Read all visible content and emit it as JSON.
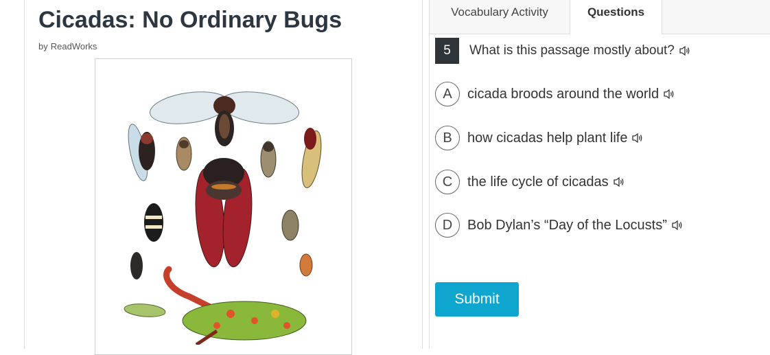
{
  "article": {
    "title": "Cicadas: No Ordinary Bugs",
    "byline_prefix": "by",
    "author": "ReadWorks"
  },
  "tabs": [
    {
      "label": "Vocabulary Activity",
      "active": false
    },
    {
      "label": "Questions",
      "active": true
    }
  ],
  "question": {
    "number": "5",
    "text": "What is this passage mostly about?",
    "options": [
      {
        "letter": "A",
        "text": "cicada broods around the world"
      },
      {
        "letter": "B",
        "text": "how cicadas help plant life"
      },
      {
        "letter": "C",
        "text": "the life cycle of cicadas"
      },
      {
        "letter": "D",
        "text": "Bob Dylan’s “Day of the Locusts”"
      }
    ],
    "submit_label": "Submit"
  },
  "colors": {
    "submit": "#0ea5cf",
    "number_badge": "#2f3439",
    "title": "#2c3741"
  },
  "icons": {
    "audio": "speaker-icon"
  }
}
